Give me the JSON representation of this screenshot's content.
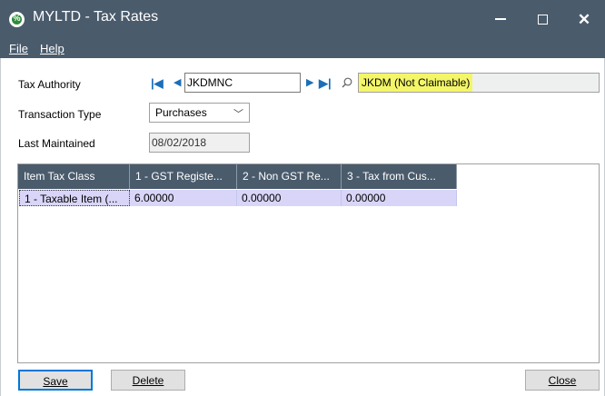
{
  "window": {
    "title": "MYLTD - Tax Rates",
    "icon_glyph": "%"
  },
  "menu": {
    "file": "File",
    "help": "Help"
  },
  "form": {
    "tax_authority_label": "Tax Authority",
    "tax_authority_value": "JKDMNC",
    "tax_authority_desc": "JKDM (Not Claimable)",
    "transaction_type_label": "Transaction Type",
    "transaction_type_value": "Purchases",
    "last_maintained_label": "Last Maintained",
    "last_maintained_value": "08/02/2018"
  },
  "grid": {
    "columns": [
      "Item Tax Class",
      "1 - GST Registe...",
      "2 - Non GST Re...",
      "3 - Tax from Cus..."
    ],
    "rows": [
      [
        "1 - Taxable Item (...",
        "6.00000",
        "0.00000",
        "0.00000"
      ]
    ]
  },
  "buttons": {
    "save": "Save",
    "delete": "Delete",
    "close": "Close"
  },
  "colors": {
    "titlebar": "#4a5b6c",
    "highlight": "#f4f66a",
    "row_selected": "#d9d5f8",
    "nav_arrows": "#1a6fb8"
  }
}
